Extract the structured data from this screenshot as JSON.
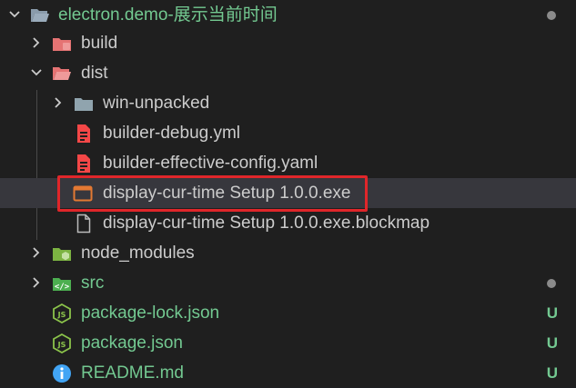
{
  "explorer": {
    "root_label": "electron.demo-展示当前时间",
    "root_status_color": "#8b8b8b",
    "colors": {
      "git_untracked": "#73c991",
      "text": "#cccccc",
      "highlight_border": "#e0262a"
    },
    "items": [
      {
        "label": "build",
        "icon": "folder-build-icon"
      },
      {
        "label": "dist",
        "icon": "folder-dist-icon"
      },
      {
        "label": "win-unpacked",
        "icon": "folder-icon"
      },
      {
        "label": "builder-debug.yml",
        "icon": "yaml-file-icon"
      },
      {
        "label": "builder-effective-config.yaml",
        "icon": "yaml-file-icon"
      },
      {
        "label": "display-cur-time Setup 1.0.0.exe",
        "icon": "exe-file-icon"
      },
      {
        "label": "display-cur-time Setup 1.0.0.exe.blockmap",
        "icon": "file-icon"
      },
      {
        "label": "node_modules",
        "icon": "folder-node-icon"
      },
      {
        "label": "src",
        "icon": "folder-src-icon"
      },
      {
        "label": "package-lock.json",
        "icon": "js-file-icon",
        "status": "U"
      },
      {
        "label": "package.json",
        "icon": "js-file-icon",
        "status": "U"
      },
      {
        "label": "README.md",
        "icon": "info-icon",
        "status": "U"
      }
    ]
  }
}
